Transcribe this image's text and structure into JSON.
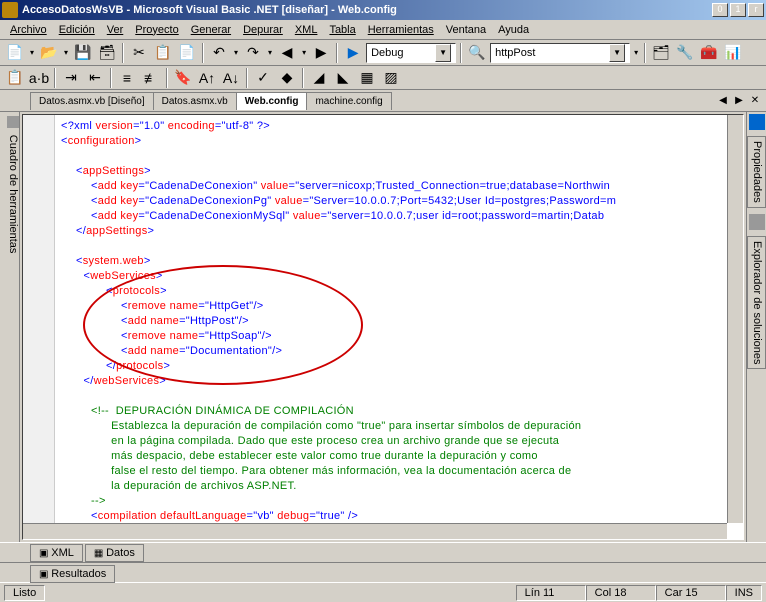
{
  "title": "AccesoDatosWsVB - Microsoft Visual Basic .NET [diseñar] - Web.config",
  "menus": [
    "Archivo",
    "Edición",
    "Ver",
    "Proyecto",
    "Generar",
    "Depurar",
    "XML",
    "Tabla",
    "Herramientas",
    "Ventana",
    "Ayuda"
  ],
  "menu_underline": [
    0,
    0,
    0,
    0,
    0,
    0,
    0,
    0,
    0,
    2,
    2
  ],
  "combo_config": "Debug",
  "combo_target": "httpPost",
  "tabs": [
    "Datos.asmx.vb [Diseño]",
    "Datos.asmx.vb",
    "Web.config",
    "machine.config"
  ],
  "active_tab": 2,
  "left_panel": "Cuadro de herramientas",
  "right_panels": [
    "Propiedades",
    "Explorador de soluciones"
  ],
  "bottom_tabs": [
    "XML",
    "Datos"
  ],
  "results": "Resultados",
  "status": {
    "ready": "Listo",
    "lin": "Lín 11",
    "col": "Col 18",
    "car": "Car 15",
    "ins": "INS"
  },
  "code": {
    "l1": {
      "a": "<?xml ",
      "b": "version",
      "c": "=\"1.0\" ",
      "d": "encoding",
      "e": "=\"utf-8\" ?>"
    },
    "l2": {
      "a": "<",
      "b": "configuration",
      "c": ">"
    },
    "l3": {
      "a": "<",
      "b": "appSettings",
      "c": ">"
    },
    "l4": {
      "a": "<",
      "b": "add ",
      "c": "key",
      "d": "=\"CadenaDeConexion\" ",
      "e": "value",
      "f": "=\"server=nicoxp;Trusted_Connection=true;database=Northwin"
    },
    "l5": {
      "a": "<",
      "b": "add ",
      "c": "key",
      "d": "=\"CadenaDeConexionPg\" ",
      "e": "value",
      "f": "=\"Server=10.0.0.7;Port=5432;User Id=postgres;Password=m"
    },
    "l6": {
      "a": "<",
      "b": "add ",
      "c": "key",
      "d": "=\"CadenaDeConexionMySql\" ",
      "e": "value",
      "f": "=\"server=10.0.0.7;user id=root;password=martin;Datab"
    },
    "l7": {
      "a": "</",
      "b": "appSettings",
      "c": ">"
    },
    "l8": {
      "a": "<",
      "b": "system.web",
      "c": ">"
    },
    "l9": {
      "a": "<",
      "b": "webServices",
      "c": ">"
    },
    "l10": {
      "a": "<",
      "b": "protocols",
      "c": ">"
    },
    "l11": {
      "a": "<",
      "b": "remove ",
      "c": "name",
      "d": "=\"HttpGet\"/>"
    },
    "l12": {
      "a": "<",
      "b": "add ",
      "c": "name",
      "d": "=\"HttpPost\"/>"
    },
    "l13": {
      "a": "<",
      "b": "remove ",
      "c": "name",
      "d": "=\"HttpSoap\"/>"
    },
    "l14": {
      "a": "<",
      "b": "add ",
      "c": "name",
      "d": "=\"Documentation\"/>"
    },
    "l15": {
      "a": "</",
      "b": "protocols",
      "c": ">"
    },
    "l16": {
      "a": "</",
      "b": "webServices",
      "c": ">"
    },
    "l17": "<!--  DEPURACIÓN DINÁMICA DE COMPILACIÓN",
    "l18": "      Establezca la depuración de compilación como \"true\" para insertar símbolos de depuración",
    "l19": "      en la página compilada. Dado que este proceso crea un archivo grande que se ejecuta",
    "l20": "      más despacio, debe establecer este valor como true durante la depuración y como",
    "l21": "      false el resto del tiempo. Para obtener más información, vea la documentación acerca de",
    "l22": "      la depuración de archivos ASP.NET.",
    "l23": "-->",
    "l24": {
      "a": "<",
      "b": "compilation ",
      "c": "defaultLanguage",
      "d": "=\"vb\" ",
      "e": "debug",
      "f": "=\"true\" />"
    }
  }
}
